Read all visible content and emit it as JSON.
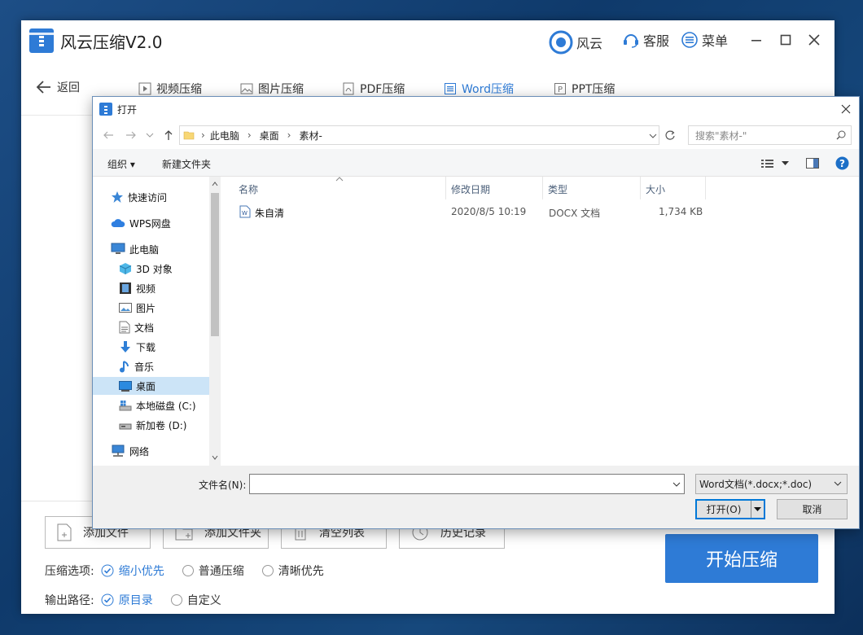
{
  "app": {
    "title": "风云压缩V2.0",
    "brand_label": "风云",
    "service_label": "客服",
    "menu_label": "菜单",
    "back_label": "返回",
    "tabs": [
      {
        "label": "视频压缩",
        "icon": "video-icon"
      },
      {
        "label": "图片压缩",
        "icon": "image-icon"
      },
      {
        "label": "PDF压缩",
        "icon": "pdf-icon"
      },
      {
        "label": "Word压缩",
        "icon": "word-icon",
        "active": true
      },
      {
        "label": "PPT压缩",
        "icon": "ppt-icon"
      }
    ],
    "actions": {
      "add_file": "添加文件",
      "add_folder": "添加文件夹",
      "clear_list": "清空列表",
      "history": "历史记录"
    },
    "compress_options": {
      "label": "压缩选项:",
      "items": [
        {
          "label": "缩小优先",
          "checked": true
        },
        {
          "label": "普通压缩",
          "checked": false
        },
        {
          "label": "清晰优先",
          "checked": false
        }
      ]
    },
    "output_path": {
      "label": "输出路径:",
      "items": [
        {
          "label": "原目录",
          "checked": true
        },
        {
          "label": "自定义",
          "checked": false
        }
      ]
    },
    "start_button": "开始压缩",
    "accent_color": "#2e7bd6"
  },
  "dialog": {
    "title": "打开",
    "breadcrumb": [
      "此电脑",
      "桌面",
      "素材-"
    ],
    "search_placeholder": "搜索\"素材-\"",
    "organize_label": "组织",
    "new_folder_label": "新建文件夹",
    "tree": [
      {
        "label": "快速访问",
        "icon": "star-icon"
      },
      {
        "label": "WPS网盘",
        "icon": "cloud-icon"
      },
      {
        "label": "此电脑",
        "icon": "computer-icon"
      },
      {
        "label": "3D 对象",
        "icon": "cube-icon"
      },
      {
        "label": "视频",
        "icon": "film-icon"
      },
      {
        "label": "图片",
        "icon": "picture-icon"
      },
      {
        "label": "文档",
        "icon": "document-icon"
      },
      {
        "label": "下载",
        "icon": "download-icon"
      },
      {
        "label": "音乐",
        "icon": "music-icon"
      },
      {
        "label": "桌面",
        "icon": "desktop-icon",
        "selected": true
      },
      {
        "label": "本地磁盘 (C:)",
        "icon": "drive-c-icon"
      },
      {
        "label": "新加卷 (D:)",
        "icon": "drive-d-icon"
      },
      {
        "label": "网络",
        "icon": "network-icon"
      }
    ],
    "columns": [
      "名称",
      "修改日期",
      "类型",
      "大小"
    ],
    "files": [
      {
        "name": "朱自清",
        "modified": "2020/8/5 10:19",
        "type": "DOCX 文档",
        "size": "1,734 KB",
        "icon": "word-doc-icon"
      }
    ],
    "filename_label": "文件名(N):",
    "filename_value": "",
    "filetype_value": "Word文档(*.docx;*.doc)",
    "open_button": "打开(O)",
    "cancel_button": "取消"
  }
}
